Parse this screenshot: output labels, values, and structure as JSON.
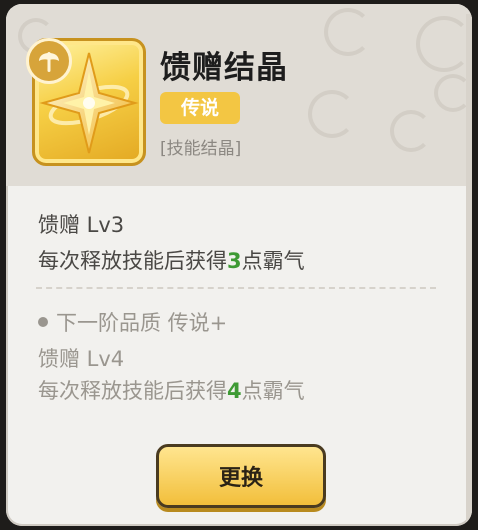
{
  "item": {
    "name": "馈赠结晶",
    "rarity": "传说",
    "type": "[技能结晶]"
  },
  "current": {
    "level_line": "馈赠 Lv3",
    "effect_prefix": "每次释放技能后获得",
    "effect_value": "3",
    "effect_suffix": "点霸气"
  },
  "next": {
    "quality_line": "下一阶品质 传说+",
    "level_line": "馈赠 Lv4",
    "effect_prefix": "每次释放技能后获得",
    "effect_value": "4",
    "effect_suffix": "点霸气"
  },
  "actions": {
    "replace_label": "更换"
  },
  "icons": {
    "item": "golden-four-point-star-crystal-icon",
    "badge": "axe-emblem-icon"
  },
  "colors": {
    "rarity_gold": "#f3c643",
    "value_green": "#3e9a34"
  }
}
